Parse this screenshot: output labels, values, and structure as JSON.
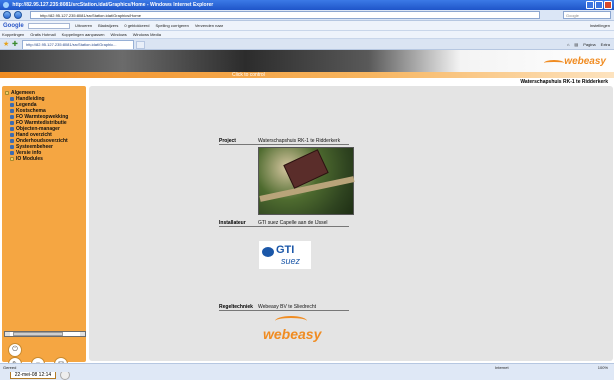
{
  "window": {
    "title": "http://82.95.127.235:8081/srcStation.idat/Graphics/Home - Windows Internet Explorer"
  },
  "addressbar": {
    "url": "http://82.95.127.235:8081/srcStation.idat/Graphics/Home",
    "search_placeholder": "Google"
  },
  "googlebar": {
    "logo": "Google",
    "tools": [
      "Uitvoeren",
      "Bladwijzers",
      "0 geblokkeerd",
      "Spelling corrigeren",
      "Verzenden naar"
    ],
    "settings": "Instellingen"
  },
  "linksbar": {
    "items": [
      "Koppelingen",
      "Gratis Hotmail",
      "Koppelingen aanpassen",
      "Windows",
      "Windows Media"
    ]
  },
  "tabbar": {
    "tab_label": "http://82.95.127.235:8081/srcStation.idat/Graphic...",
    "commands": [
      "Pagina",
      "Extra"
    ]
  },
  "app": {
    "header_text": "Click to control",
    "logo_text": "webeasy",
    "location": "Waterschapshuis RK-1 te Ridderkerk",
    "tree": {
      "root": "Algemeen",
      "items": [
        "Handleiding",
        "Legenda",
        "Kostschema",
        "FO Warmteopwekking",
        "FO Warmtedistributie",
        "Objecten-manager",
        "Hand overzicht",
        "Onderhoudsoverzicht",
        "Systeembeheer",
        "Versie info",
        "IO Modules"
      ]
    },
    "clock": "22-mei-08 12:14"
  },
  "content": {
    "project_label": "Project",
    "project_value": "Waterschapshuis RK-1 te Ridderkerk",
    "installer_label": "Installateur",
    "installer_value": "GTI suez Capelle aan de IJssel",
    "control_label": "Regeltechniek",
    "control_value": "Webeasy BV te Sliedrecht",
    "gti_logo": "GTI",
    "gti_logo_sub": "suez",
    "bottom_logo": "webeasy"
  },
  "statusbar": {
    "left": "Gereed",
    "zone": "Internet",
    "zoom": "100%"
  }
}
